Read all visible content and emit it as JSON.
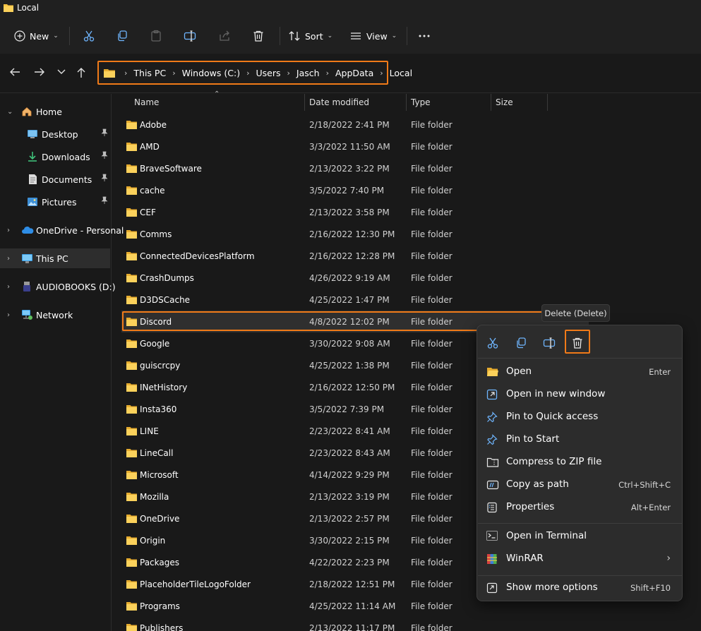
{
  "window": {
    "title": "Local"
  },
  "commandbar": {
    "new_label": "New",
    "sort_label": "Sort",
    "view_label": "View"
  },
  "address": {
    "crumbs": [
      "This PC",
      "Windows (C:)",
      "Users",
      "Jasch",
      "AppData",
      "Local"
    ]
  },
  "sidebar": {
    "home": "Home",
    "desktop": "Desktop",
    "downloads": "Downloads",
    "documents": "Documents",
    "pictures": "Pictures",
    "onedrive": "OneDrive - Personal",
    "thispc": "This PC",
    "audiobooks": "AUDIOBOOKS (D:)",
    "network": "Network"
  },
  "columns": {
    "name": "Name",
    "date": "Date modified",
    "type": "Type",
    "size": "Size"
  },
  "files": [
    {
      "name": "Adobe",
      "date": "2/18/2022 2:41 PM",
      "type": "File folder"
    },
    {
      "name": "AMD",
      "date": "3/3/2022 11:50 AM",
      "type": "File folder"
    },
    {
      "name": "BraveSoftware",
      "date": "2/13/2022 3:22 PM",
      "type": "File folder"
    },
    {
      "name": "cache",
      "date": "3/5/2022 7:40 PM",
      "type": "File folder"
    },
    {
      "name": "CEF",
      "date": "2/13/2022 3:58 PM",
      "type": "File folder"
    },
    {
      "name": "Comms",
      "date": "2/16/2022 12:30 PM",
      "type": "File folder"
    },
    {
      "name": "ConnectedDevicesPlatform",
      "date": "2/16/2022 12:28 PM",
      "type": "File folder"
    },
    {
      "name": "CrashDumps",
      "date": "4/26/2022 9:19 AM",
      "type": "File folder"
    },
    {
      "name": "D3DSCache",
      "date": "4/25/2022 1:47 PM",
      "type": "File folder"
    },
    {
      "name": "Discord",
      "date": "4/8/2022 12:02 PM",
      "type": "File folder"
    },
    {
      "name": "Google",
      "date": "3/30/2022 9:08 AM",
      "type": "File folder"
    },
    {
      "name": "guiscrcpy",
      "date": "4/25/2022 1:38 PM",
      "type": "File folder"
    },
    {
      "name": "INetHistory",
      "date": "2/16/2022 12:50 PM",
      "type": "File folder"
    },
    {
      "name": "Insta360",
      "date": "3/5/2022 7:39 PM",
      "type": "File folder"
    },
    {
      "name": "LINE",
      "date": "2/23/2022 8:41 AM",
      "type": "File folder"
    },
    {
      "name": "LineCall",
      "date": "2/23/2022 8:43 AM",
      "type": "File folder"
    },
    {
      "name": "Microsoft",
      "date": "4/14/2022 9:29 PM",
      "type": "File folder"
    },
    {
      "name": "Mozilla",
      "date": "2/13/2022 3:19 PM",
      "type": "File folder"
    },
    {
      "name": "OneDrive",
      "date": "2/13/2022 2:57 PM",
      "type": "File folder"
    },
    {
      "name": "Origin",
      "date": "3/30/2022 2:15 PM",
      "type": "File folder"
    },
    {
      "name": "Packages",
      "date": "4/22/2022 2:23 PM",
      "type": "File folder"
    },
    {
      "name": "PlaceholderTileLogoFolder",
      "date": "2/18/2022 12:51 PM",
      "type": "File folder"
    },
    {
      "name": "Programs",
      "date": "4/25/2022 11:14 AM",
      "type": "File folder"
    },
    {
      "name": "Publishers",
      "date": "2/13/2022 11:17 PM",
      "type": "File folder"
    }
  ],
  "tooltip": {
    "text": "Delete (Delete)"
  },
  "context_menu": {
    "items": [
      {
        "label": "Open",
        "shortcut": "Enter"
      },
      {
        "label": "Open in new window",
        "shortcut": ""
      },
      {
        "label": "Pin to Quick access",
        "shortcut": ""
      },
      {
        "label": "Pin to Start",
        "shortcut": ""
      },
      {
        "label": "Compress to ZIP file",
        "shortcut": ""
      },
      {
        "label": "Copy as path",
        "shortcut": "Ctrl+Shift+C"
      },
      {
        "label": "Properties",
        "shortcut": "Alt+Enter"
      },
      {
        "label": "Open in Terminal",
        "shortcut": ""
      },
      {
        "label": "WinRAR",
        "shortcut": ""
      },
      {
        "label": "Show more options",
        "shortcut": "Shift+F10"
      }
    ]
  },
  "colors": {
    "accent_highlight": "#f07a18",
    "folder": "#f7c443",
    "background": "#191919"
  }
}
